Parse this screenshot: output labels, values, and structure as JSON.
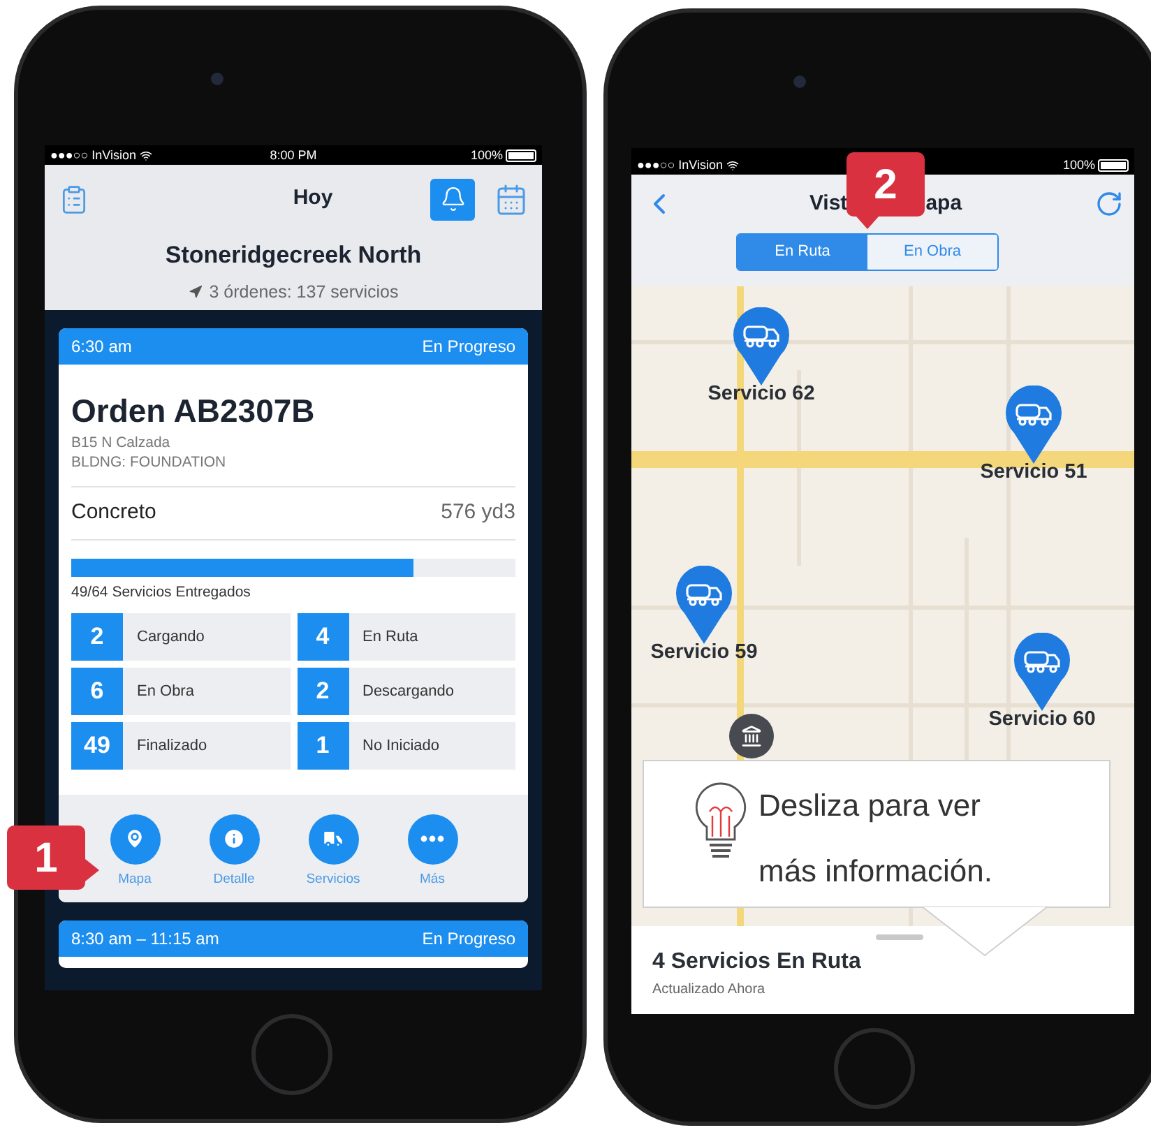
{
  "order_screen": {
    "status_bar": {
      "carrier": "●●●○○ InVision",
      "time": "8:00 PM",
      "battery": "100%"
    },
    "title": "Hoy",
    "bell_highlighted": true,
    "site_name": "Stoneridgecreek North",
    "site_summary": "3 órdenes: 137 servicios",
    "orders": [
      {
        "time": "6:30 am",
        "status": "En Progreso",
        "name": "Orden AB2307B",
        "address": "B15 N Calzada",
        "building": "BLDNG: FOUNDATION",
        "material": "Concreto",
        "quantity": "576 yd3",
        "level": 0.77,
        "progress_label": "49/64 Servicios Entregados",
        "counts": [
          {
            "count": "2",
            "label": "Cargando"
          },
          {
            "count": "4",
            "label": "En Ruta"
          },
          {
            "count": "6",
            "label": "En Obra"
          },
          {
            "count": "2",
            "label": "Descargando"
          },
          {
            "count": "49",
            "label": "Finalizado"
          },
          {
            "count": "1",
            "label": "No Iniciado"
          }
        ],
        "actions": [
          {
            "kind": "map",
            "label": "Mapa"
          },
          {
            "kind": "info",
            "label": "Detalle"
          },
          {
            "kind": "truck",
            "label": "Servicios"
          },
          {
            "kind": "more",
            "label": "Más"
          }
        ]
      },
      {
        "time": "8:30 am – 11:15 am",
        "status": "En Progreso"
      }
    ]
  },
  "map_screen": {
    "status_bar": {
      "carrier": "●●●○○ InVision",
      "battery": "100%"
    },
    "title_start": "Vist",
    "title_end": "apa",
    "segments": [
      {
        "label": "En Ruta",
        "selected": true
      },
      {
        "label": "En Obra",
        "selected": false
      }
    ],
    "pins": [
      {
        "label": "Servicio 62"
      },
      {
        "label": "Servicio 51"
      },
      {
        "label": "Servicio 59"
      },
      {
        "label": "Servicio 60"
      }
    ],
    "summary": "4 Servicios En Ruta",
    "updated": "Actualizado Ahora"
  },
  "tip": {
    "text": "Desliza para ver más información."
  },
  "callouts": [
    {
      "number": "1"
    },
    {
      "number": "2"
    }
  ]
}
